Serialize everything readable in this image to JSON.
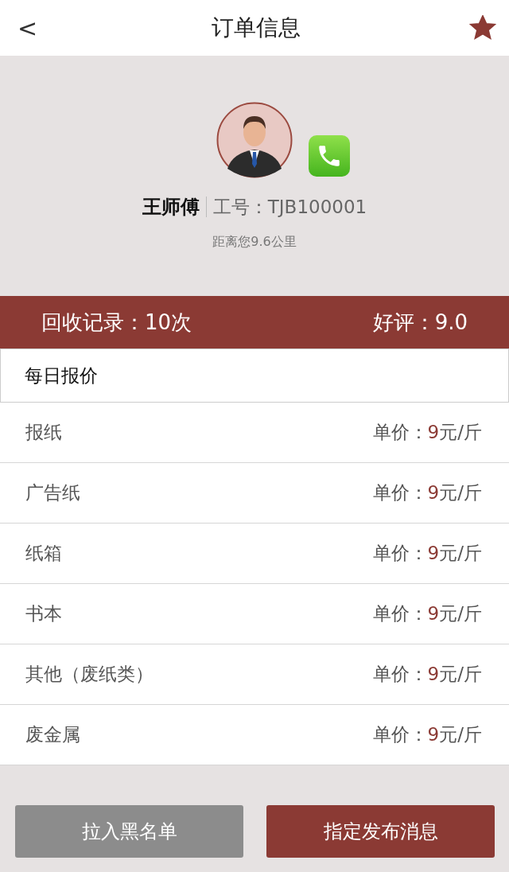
{
  "header": {
    "back": "<",
    "title": "订单信息",
    "favorite": true
  },
  "profile": {
    "name": "王师傅",
    "id_label": "工号：TJB100001",
    "distance": "距离您9.6公里"
  },
  "stats": {
    "records": "回收记录：10次",
    "rating": "好评：9.0"
  },
  "section_title": "每日报价",
  "prices": [
    {
      "name": "报纸",
      "label": "单价：",
      "value": "9",
      "unit": "元/斤"
    },
    {
      "name": "广告纸",
      "label": "单价：",
      "value": "9",
      "unit": "元/斤"
    },
    {
      "name": "纸箱",
      "label": "单价：",
      "value": "9",
      "unit": "元/斤"
    },
    {
      "name": "书本",
      "label": "单价：",
      "value": "9",
      "unit": "元/斤"
    },
    {
      "name": "其他（废纸类）",
      "label": "单价：",
      "value": "9",
      "unit": "元/斤"
    },
    {
      "name": "废金属",
      "label": "单价：",
      "value": "9",
      "unit": "元/斤"
    }
  ],
  "buttons": [
    {
      "label": "拉入黑名单",
      "kind": "secondary"
    },
    {
      "label": "指定发布消息",
      "kind": "primary"
    }
  ]
}
